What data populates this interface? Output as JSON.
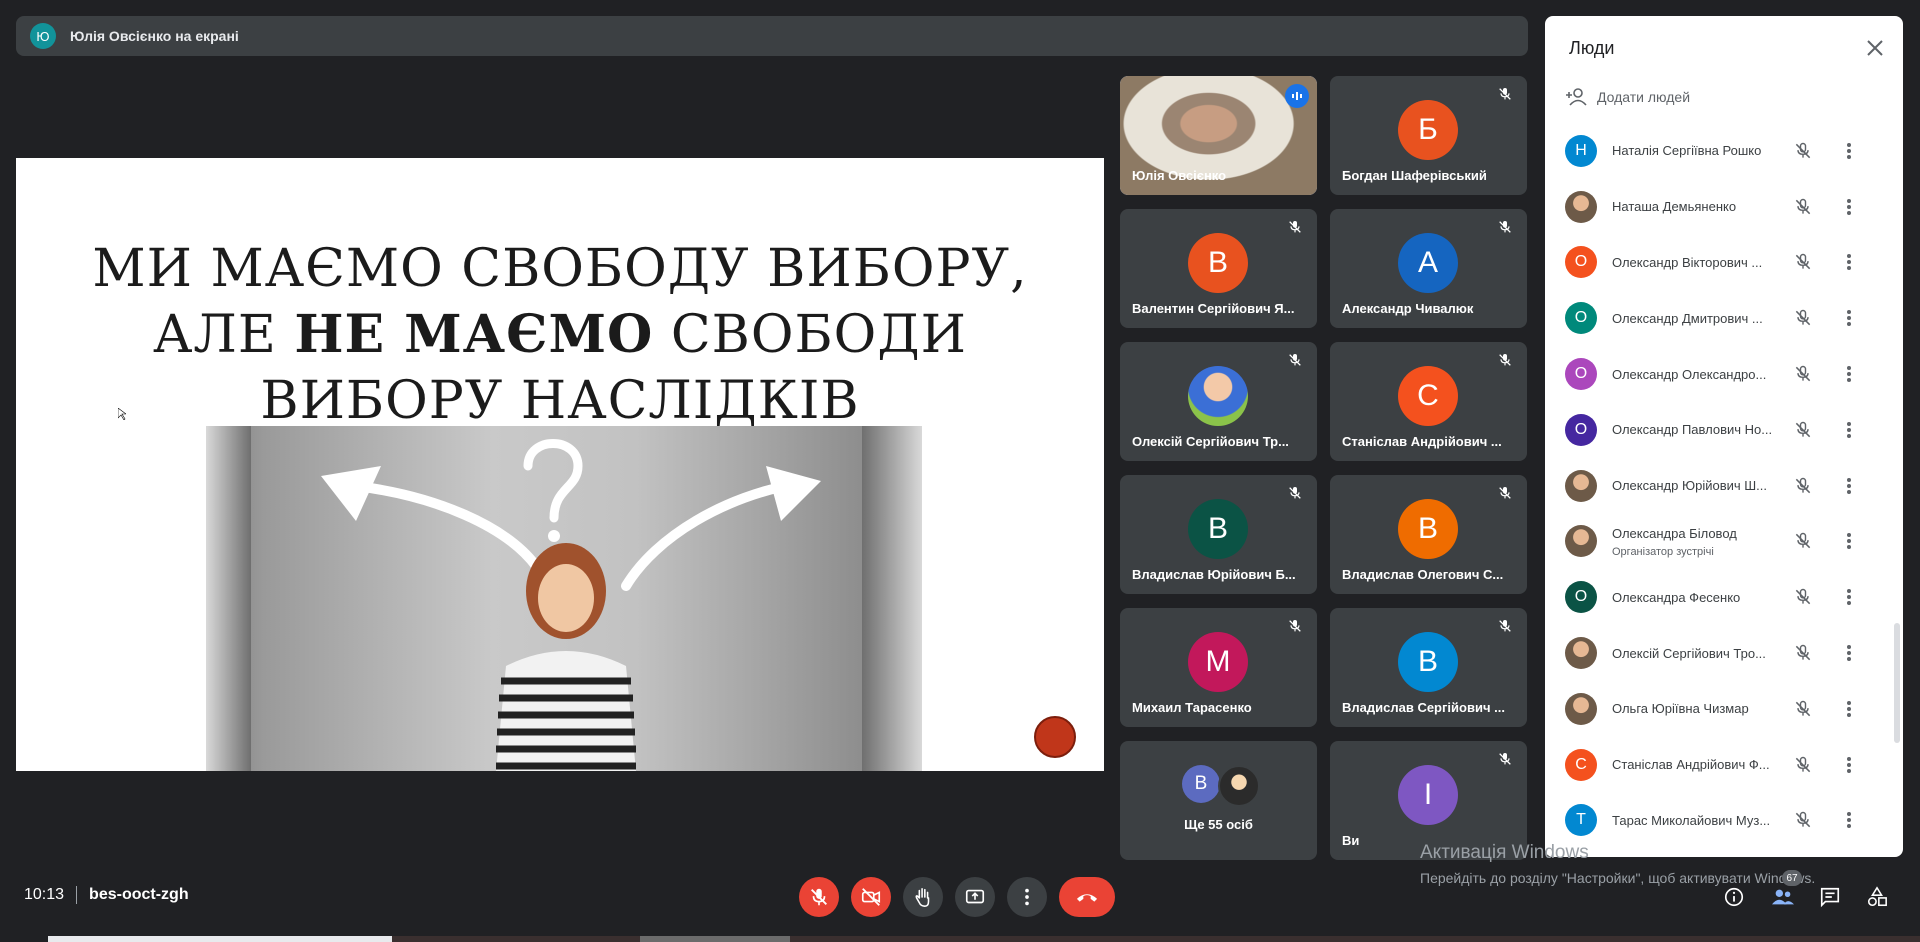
{
  "banner": {
    "avatar_letter": "Ю",
    "text": "Юлія Овсієнко на екрані",
    "avatar_color": "#12939a"
  },
  "slide": {
    "line1": "МИ МАЄМО СВОБОДУ ВИБОРУ,",
    "line2_pre": "АЛЕ ",
    "line2_bold": "НЕ МАЄМО",
    "line2_post": " СВОБОДИ",
    "line3": "ВИБОРУ НАСЛІДКІВ"
  },
  "tiles": [
    {
      "name": "Юлія Овсієнко",
      "type": "video",
      "speaking": true
    },
    {
      "name": "Богдан Шаферівський",
      "letter": "Б",
      "color": "#e8521f",
      "muted": true
    },
    {
      "name": "Валентин Сергійович Я...",
      "letter": "В",
      "color": "#e8521f",
      "muted": true
    },
    {
      "name": "Александр Чивалюк",
      "letter": "А",
      "color": "#1565c0",
      "muted": true
    },
    {
      "name": "Олексій Сергійович Тр...",
      "type": "photo",
      "muted": true
    },
    {
      "name": "Станіслав Андрійович ...",
      "letter": "С",
      "color": "#f4511e",
      "muted": true
    },
    {
      "name": "Владислав Юрійович Б...",
      "letter": "В",
      "color": "#0b5345",
      "muted": true
    },
    {
      "name": "Владислав Олегович С...",
      "letter": "В",
      "color": "#ef6c00",
      "muted": true
    },
    {
      "name": "Михаил Тарасенко",
      "letter": "М",
      "color": "#c2185b",
      "muted": true
    },
    {
      "name": "Владислав Сергійович ...",
      "letter": "В",
      "color": "#0288d1",
      "muted": true
    },
    {
      "name": "Ще 55 осіб",
      "type": "more",
      "letter": "В"
    },
    {
      "name": "Ви",
      "letter": "І",
      "color": "#7e57c2",
      "muted": true
    }
  ],
  "panel": {
    "title": "Люди",
    "add_people": "Додати людей",
    "people": [
      {
        "name": "Наталія Сергіївна Рошко",
        "letter": "Н",
        "color": "#0288d1"
      },
      {
        "name": "Наташа Демьяненко",
        "type": "img"
      },
      {
        "name": "Олександр Вікторович ...",
        "letter": "О",
        "color": "#f4511e"
      },
      {
        "name": "Олександр Дмитрович ...",
        "letter": "О",
        "color": "#00897b"
      },
      {
        "name": "Олександр Олександро...",
        "letter": "О",
        "color": "#ab47bc"
      },
      {
        "name": "Олександр Павлович Но...",
        "letter": "О",
        "color": "#4527a0"
      },
      {
        "name": "Олександр Юрійович Ш...",
        "type": "img"
      },
      {
        "name": "Олександра Біловод",
        "sub": "Організатор зустрічі",
        "type": "img"
      },
      {
        "name": "Олександра Фесенко",
        "letter": "О",
        "color": "#0b5345"
      },
      {
        "name": "Олексій Сергійович Тро...",
        "type": "img"
      },
      {
        "name": "Ольга Юріївна Чизмар",
        "type": "img"
      },
      {
        "name": "Станіслав Андрійович Ф...",
        "letter": "С",
        "color": "#f4511e"
      },
      {
        "name": "Тарас Миколайович Муз...",
        "letter": "Т",
        "color": "#0288d1"
      }
    ]
  },
  "watermark": {
    "line1": "Активація Windows",
    "line2": "Перейдіть до розділу \"Настройки\", щоб активувати Windows."
  },
  "bottom": {
    "time": "10:13",
    "meeting_code": "bes-ooct-zgh",
    "participants_badge": "67"
  },
  "colors": {
    "accent": "#8ab4f8",
    "danger": "#ea4335",
    "bg": "#202124",
    "tile": "#3c4043"
  }
}
